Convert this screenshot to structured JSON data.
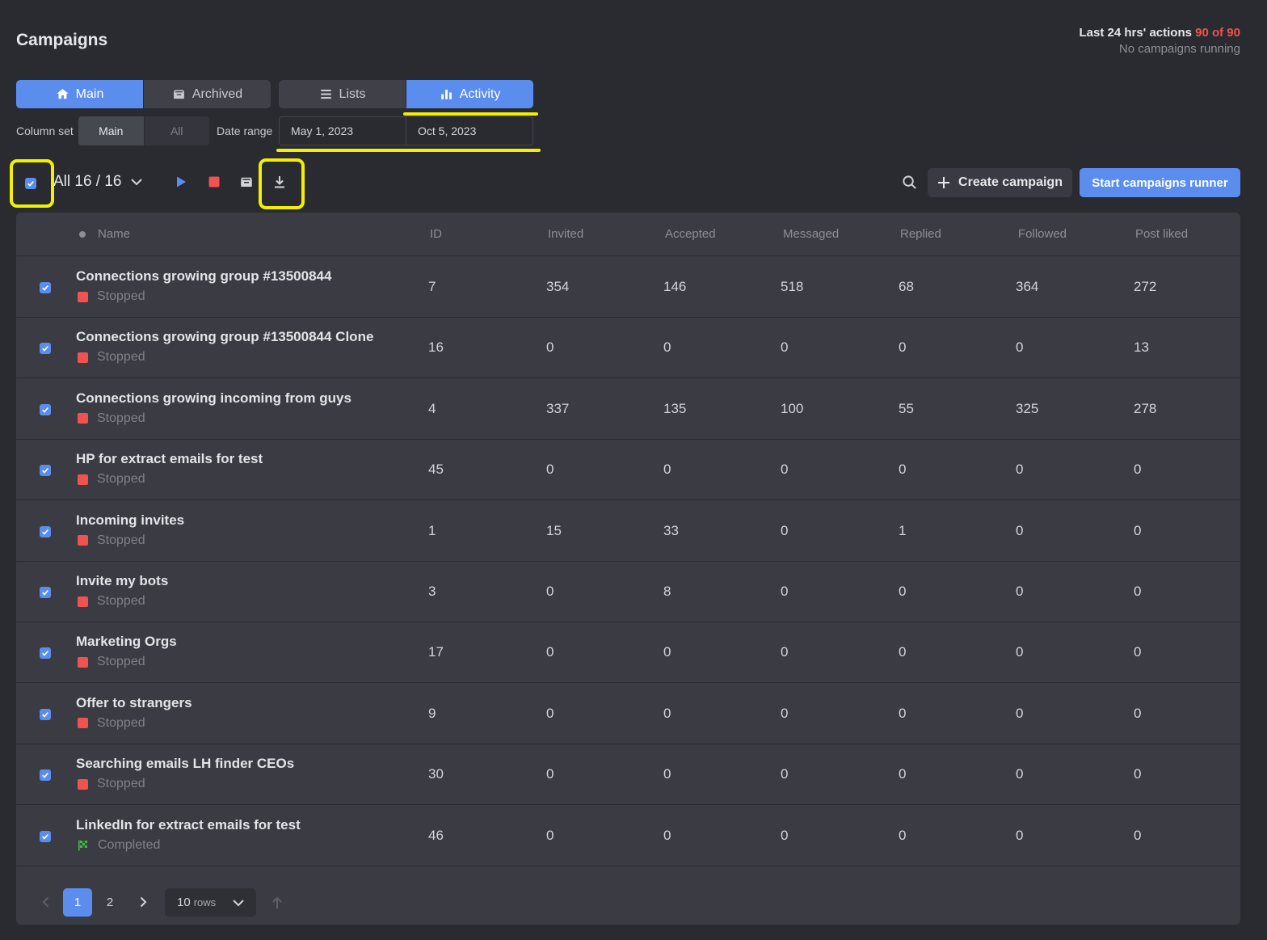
{
  "header": {
    "title": "Campaigns",
    "stats_label": "Last 24 hrs' actions",
    "stats_count": "90 of 90",
    "stats_status": "No campaigns running"
  },
  "tabs": {
    "main": "Main",
    "archived": "Archived",
    "lists": "Lists",
    "activity": "Activity"
  },
  "filters": {
    "column_set_label": "Column set",
    "column_set_options": [
      "Main",
      "All"
    ],
    "column_set_selected": "Main",
    "date_range_label": "Date range",
    "date_from": "May 1, 2023",
    "date_to": "Oct 5, 2023"
  },
  "toolbar": {
    "selection": "All 16 / 16",
    "create_label": "Create campaign",
    "start_label": "Start campaigns runner"
  },
  "table": {
    "columns": [
      "Name",
      "ID",
      "Invited",
      "Accepted",
      "Messaged",
      "Replied",
      "Followed",
      "Post liked"
    ],
    "rows": [
      {
        "name": "Connections growing group #13500844",
        "status": "Stopped",
        "id": "7",
        "invited": "354",
        "accepted": "146",
        "messaged": "518",
        "replied": "68",
        "followed": "364",
        "post_liked": "272"
      },
      {
        "name": "Connections growing group #13500844 Clone",
        "status": "Stopped",
        "id": "16",
        "invited": "0",
        "accepted": "0",
        "messaged": "0",
        "replied": "0",
        "followed": "0",
        "post_liked": "13"
      },
      {
        "name": "Connections growing incoming from guys",
        "status": "Stopped",
        "id": "4",
        "invited": "337",
        "accepted": "135",
        "messaged": "100",
        "replied": "55",
        "followed": "325",
        "post_liked": "278"
      },
      {
        "name": "HP for extract emails for test",
        "status": "Stopped",
        "id": "45",
        "invited": "0",
        "accepted": "0",
        "messaged": "0",
        "replied": "0",
        "followed": "0",
        "post_liked": "0"
      },
      {
        "name": "Incoming invites",
        "status": "Stopped",
        "id": "1",
        "invited": "15",
        "accepted": "33",
        "messaged": "0",
        "replied": "1",
        "followed": "0",
        "post_liked": "0"
      },
      {
        "name": "Invite my bots",
        "status": "Stopped",
        "id": "3",
        "invited": "0",
        "accepted": "8",
        "messaged": "0",
        "replied": "0",
        "followed": "0",
        "post_liked": "0"
      },
      {
        "name": "Marketing Orgs",
        "status": "Stopped",
        "id": "17",
        "invited": "0",
        "accepted": "0",
        "messaged": "0",
        "replied": "0",
        "followed": "0",
        "post_liked": "0"
      },
      {
        "name": "Offer to strangers",
        "status": "Stopped",
        "id": "9",
        "invited": "0",
        "accepted": "0",
        "messaged": "0",
        "replied": "0",
        "followed": "0",
        "post_liked": "0"
      },
      {
        "name": "Searching emails LH finder CEOs",
        "status": "Stopped",
        "id": "30",
        "invited": "0",
        "accepted": "0",
        "messaged": "0",
        "replied": "0",
        "followed": "0",
        "post_liked": "0"
      },
      {
        "name": "LinkedIn for extract emails for test",
        "status": "Completed",
        "id": "46",
        "invited": "0",
        "accepted": "0",
        "messaged": "0",
        "replied": "0",
        "followed": "0",
        "post_liked": "0"
      }
    ]
  },
  "pagination": {
    "pages": [
      "1",
      "2"
    ],
    "current": "1",
    "rows_value": "10",
    "rows_unit": "rows"
  },
  "colors": {
    "accent": "#5b8def",
    "stopped": "#ef5350",
    "completed": "#4caf50",
    "highlight": "#f2f000"
  },
  "icons": {
    "main_tab": "home-icon",
    "archived_tab": "archive-icon",
    "lists_tab": "list-icon",
    "activity_tab": "bar-chart-icon",
    "start": "play-icon",
    "stop": "stop-icon",
    "archive": "archive-icon",
    "export": "download-icon",
    "search": "search-icon",
    "create": "plus-icon",
    "completed_status": "checkered-flag-icon"
  }
}
